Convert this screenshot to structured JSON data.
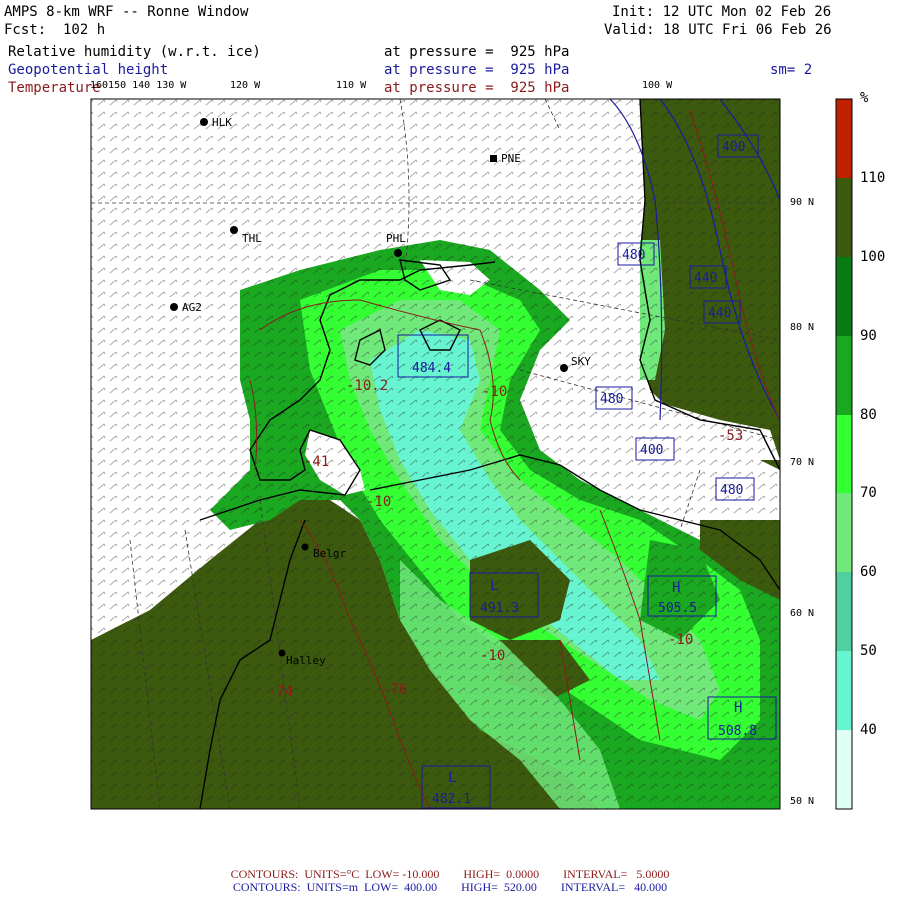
{
  "header": {
    "title": "AMPS 8-km WRF -- Ronne Window",
    "init": "Init: 12 UTC Mon 02 Feb 26",
    "fcst": "Fcst:  102 h",
    "valid": "Valid: 18 UTC Fri 06 Feb 26",
    "sm": "sm= 2",
    "fields": [
      {
        "name": "Relative humidity (w.r.t. ice)",
        "level": "at pressure =  925 hPa"
      },
      {
        "name": "Geopotential height",
        "level": "at pressure =  925 hPa"
      },
      {
        "name": "Temperature",
        "level": "at pressure =  925 hPa"
      }
    ]
  },
  "lon_labels": [
    "160150 140 130 W",
    "120 W",
    "110 W",
    "100 W"
  ],
  "lat_labels": [
    "90 N",
    "80 N",
    "70 N",
    "60 N",
    "50 N"
  ],
  "stations": [
    "HLK",
    "PNE",
    "PHL",
    "THL",
    "AG2",
    "SKY",
    "Belgr",
    "Halley"
  ],
  "height_boxes": [
    "480",
    "440",
    "440",
    "400",
    "480",
    "400",
    "480",
    "484.4",
    "491.3",
    "505.5",
    "508.8",
    "482.1"
  ],
  "map_labels": {
    "highs": [
      "H",
      "H"
    ],
    "lows": [
      "L",
      "L"
    ],
    "temps": [
      "-10.2",
      "-10",
      "-10",
      "-10",
      "-53",
      "-41",
      "-10",
      "-74",
      "-76"
    ]
  },
  "colorbar": {
    "unit": "%",
    "ticks": [
      "110",
      "100",
      "90",
      "80",
      "70",
      "60",
      "50",
      "40"
    ],
    "colors": [
      "#c02000",
      "#3c5a0e",
      "#0a7a14",
      "#1aa820",
      "#33ff33",
      "#70e87a",
      "#50d0a0",
      "#66f5d0",
      "#e0fff4"
    ]
  },
  "footer": {
    "temp_line": "CONTOURS:  UNITS=°C  LOW= -10.000        HIGH=  0.0000        INTERVAL=   5.0000",
    "height_line": "CONTOURS:  UNITS=m  LOW=  400.00        HIGH=  520.00        INTERVAL=   40.000"
  }
}
